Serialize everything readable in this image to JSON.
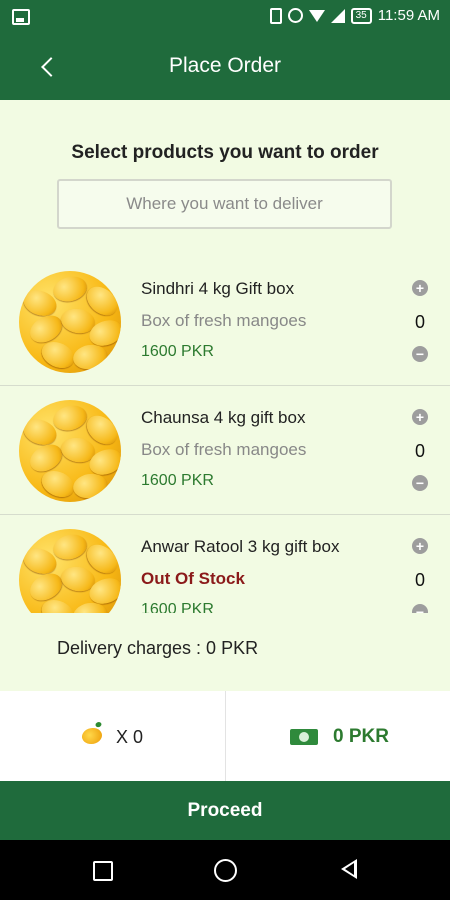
{
  "status_bar": {
    "battery": "35",
    "time": "11:59 AM"
  },
  "app_bar": {
    "title": "Place Order"
  },
  "heading": "Select products you want to order",
  "delivery_input": {
    "placeholder": "Where you want to deliver",
    "value": ""
  },
  "products": [
    {
      "name": "Sindhri 4 kg Gift box",
      "description": "Box of fresh mangoes",
      "price": "1600 PKR",
      "quantity": "0"
    },
    {
      "name": "Chaunsa 4 kg gift box",
      "description": "Box of fresh mangoes",
      "price": "1600 PKR",
      "quantity": "0"
    },
    {
      "name": "Anwar Ratool 3 kg gift box",
      "description": "Out Of Stock",
      "price": "1600 PKR",
      "quantity": "0"
    }
  ],
  "delivery_charges": "Delivery charges : 0 PKR",
  "summary": {
    "count": "X 0",
    "total": "0 PKR"
  },
  "proceed_label": "Proceed",
  "colors": {
    "primary": "#1f6b3c",
    "background": "#f2fbe3",
    "price_green": "#2c7a2f",
    "out_of_stock": "#8b1a1a"
  }
}
